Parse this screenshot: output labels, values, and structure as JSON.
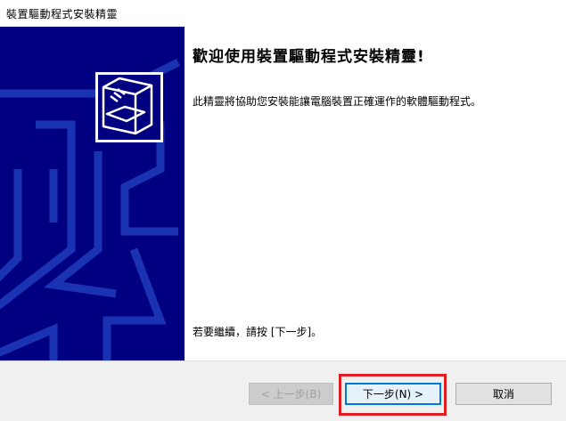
{
  "window": {
    "title": "裝置驅動程式安裝精靈"
  },
  "main": {
    "heading": "歡迎使用裝置驅動程式安裝精靈!",
    "description": "此精靈將協助您安裝能讓電腦裝置正確運作的軟體驅動程式。",
    "continue_hint": "若要繼續，請按 [下一步]。"
  },
  "footer": {
    "back_label": "< 上一步(B)",
    "next_label": "下一步(N) >",
    "cancel_label": "取消"
  },
  "colors": {
    "panel": "#000080",
    "highlight": "#e11d24",
    "accent": "#0078d7"
  },
  "icons": {
    "wizard": "device-install-icon"
  }
}
